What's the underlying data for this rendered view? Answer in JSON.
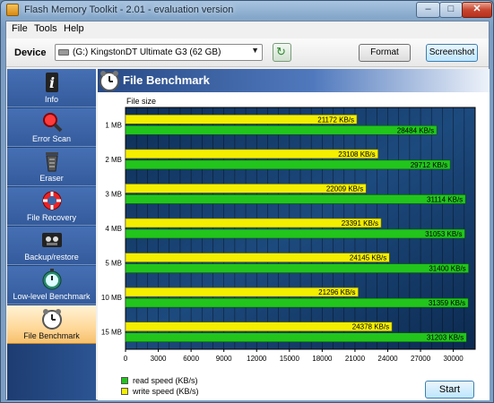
{
  "window": {
    "title": "Flash Memory Toolkit - 2.01 - evaluation version"
  },
  "menu": [
    "File",
    "Tools",
    "Help"
  ],
  "device": {
    "label": "Device",
    "value": "(G:) KingstonDT Ultimate G3 (62 GB)"
  },
  "buttons": {
    "format": "Format",
    "screenshot": "Screenshot",
    "start": "Start"
  },
  "nav": [
    {
      "label": "Info",
      "icon": "info-icon"
    },
    {
      "label": "Error Scan",
      "icon": "magnifier-icon"
    },
    {
      "label": "Eraser",
      "icon": "trash-icon"
    },
    {
      "label": "File Recovery",
      "icon": "lifebuoy-icon"
    },
    {
      "label": "Backup/restore",
      "icon": "cassette-icon"
    },
    {
      "label": "Low-level Benchmark",
      "icon": "stopwatch-icon"
    },
    {
      "label": "File Benchmark",
      "icon": "alarm-clock-icon",
      "active": true
    }
  ],
  "section": {
    "title": "File Benchmark",
    "file_size_label": "File size"
  },
  "colors": {
    "read": "#22c51c",
    "write": "#f4ee00",
    "plot_bg": "#123a66"
  },
  "chart_data": {
    "type": "bar",
    "orientation": "horizontal",
    "categories": [
      "1 MB",
      "2 MB",
      "3 MB",
      "4 MB",
      "5 MB",
      "10 MB",
      "15 MB"
    ],
    "series": [
      {
        "name": "write speed (KB/s)",
        "values": [
          21172,
          23108,
          22009,
          23391,
          24145,
          21296,
          24378
        ],
        "labels": [
          "21172 KB/s",
          "23108 KB/s",
          "22009 KB/s",
          "23391 KB/s",
          "24145 KB/s",
          "21296 KB/s",
          "24378 KB/s"
        ]
      },
      {
        "name": "read speed (KB/s)",
        "values": [
          28484,
          29712,
          31114,
          31053,
          31400,
          31359,
          31203
        ],
        "labels": [
          "28484 KB/s",
          "29712 KB/s",
          "31114 KB/s",
          "31053 KB/s",
          "31400 KB/s",
          "31359 KB/s",
          "31203 KB/s"
        ]
      }
    ],
    "xticks": [
      0,
      3000,
      6000,
      9000,
      12000,
      15000,
      18000,
      21000,
      24000,
      27000,
      30000
    ],
    "xlim": [
      0,
      32000
    ],
    "legend": [
      "read speed (KB/s)",
      "write speed (KB/s)"
    ],
    "grid": true
  }
}
